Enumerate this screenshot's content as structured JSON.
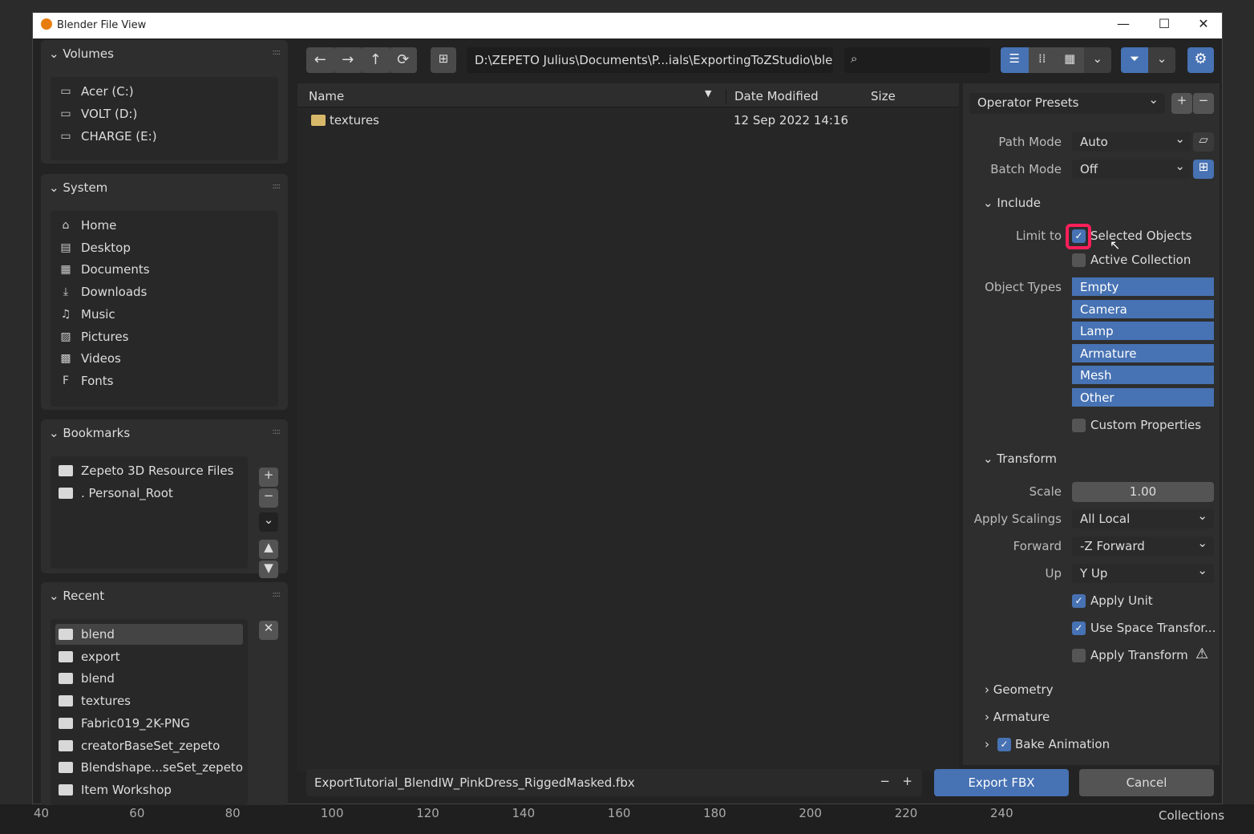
{
  "window": {
    "title": "Blender File View",
    "minimize": "—",
    "maximize": "☐",
    "close": "✕"
  },
  "sidebar": {
    "volumes": {
      "title": "Volumes",
      "items": [
        {
          "label": "Acer (C:)"
        },
        {
          "label": "VOLT (D:)"
        },
        {
          "label": "CHARGE (E:)"
        }
      ]
    },
    "system": {
      "title": "System",
      "items": [
        {
          "label": "Home",
          "icon": "⌂"
        },
        {
          "label": "Desktop",
          "icon": "▤"
        },
        {
          "label": "Documents",
          "icon": "▦"
        },
        {
          "label": "Downloads",
          "icon": "⤓"
        },
        {
          "label": "Music",
          "icon": "♫"
        },
        {
          "label": "Pictures",
          "icon": "▨"
        },
        {
          "label": "Videos",
          "icon": "▩"
        },
        {
          "label": "Fonts",
          "icon": "F"
        }
      ]
    },
    "bookmarks": {
      "title": "Bookmarks",
      "items": [
        {
          "label": "Zepeto 3D Resource Files"
        },
        {
          "label": ". Personal_Root"
        }
      ]
    },
    "recent": {
      "title": "Recent",
      "items": [
        {
          "label": "blend"
        },
        {
          "label": "export"
        },
        {
          "label": "blend"
        },
        {
          "label": "textures"
        },
        {
          "label": "Fabric019_2K-PNG"
        },
        {
          "label": "creatorBaseSet_zepeto"
        },
        {
          "label": "Blendshape...seSet_zepeto"
        },
        {
          "label": "Item Workshop"
        }
      ]
    }
  },
  "toolbar": {
    "path": "D:\\ZEPETO Julius\\Documents\\P...ials\\ExportingToZStudio\\blend\\",
    "search_placeholder": ""
  },
  "filelist": {
    "columns": {
      "name": "Name",
      "date": "Date Modified",
      "size": "Size"
    },
    "rows": [
      {
        "name": "textures",
        "date": "12 Sep 2022 14:16",
        "size": ""
      }
    ]
  },
  "footer": {
    "filename": "ExportTutorial_BlendIW_PinkDress_RiggedMasked.fbx",
    "export": "Export FBX",
    "cancel": "Cancel"
  },
  "options": {
    "presets": "Operator Presets",
    "path_mode": {
      "label": "Path Mode",
      "value": "Auto"
    },
    "batch_mode": {
      "label": "Batch Mode",
      "value": "Off"
    },
    "include": {
      "title": "Include",
      "limit_to": "Limit to",
      "selected_objects": {
        "label": "Selected Objects",
        "checked": true
      },
      "active_collection": {
        "label": "Active Collection",
        "checked": false
      },
      "object_types_label": "Object Types",
      "object_types": [
        "Empty",
        "Camera",
        "Lamp",
        "Armature",
        "Mesh",
        "Other"
      ],
      "custom_properties": {
        "label": "Custom Properties",
        "checked": false
      }
    },
    "transform": {
      "title": "Transform",
      "scale_label": "Scale",
      "scale": "1.00",
      "apply_scalings_label": "Apply Scalings",
      "apply_scalings": "All Local",
      "forward_label": "Forward",
      "forward": "-Z Forward",
      "up_label": "Up",
      "up": "Y Up",
      "apply_unit": {
        "label": "Apply Unit",
        "checked": true
      },
      "use_space": {
        "label": "Use Space Transfor...",
        "checked": true
      },
      "apply_transform": {
        "label": "Apply Transform",
        "checked": false
      }
    },
    "geometry": "Geometry",
    "armature": "Armature",
    "bake_animation": {
      "label": "Bake Animation",
      "checked": true
    }
  },
  "background": {
    "ruler": [
      "40",
      "60",
      "80",
      "100",
      "120",
      "140",
      "160",
      "180",
      "200",
      "220",
      "240"
    ],
    "collections": "Collections"
  },
  "colors": {
    "accent": "#4772b3",
    "highlight": "#ff1f5a"
  }
}
